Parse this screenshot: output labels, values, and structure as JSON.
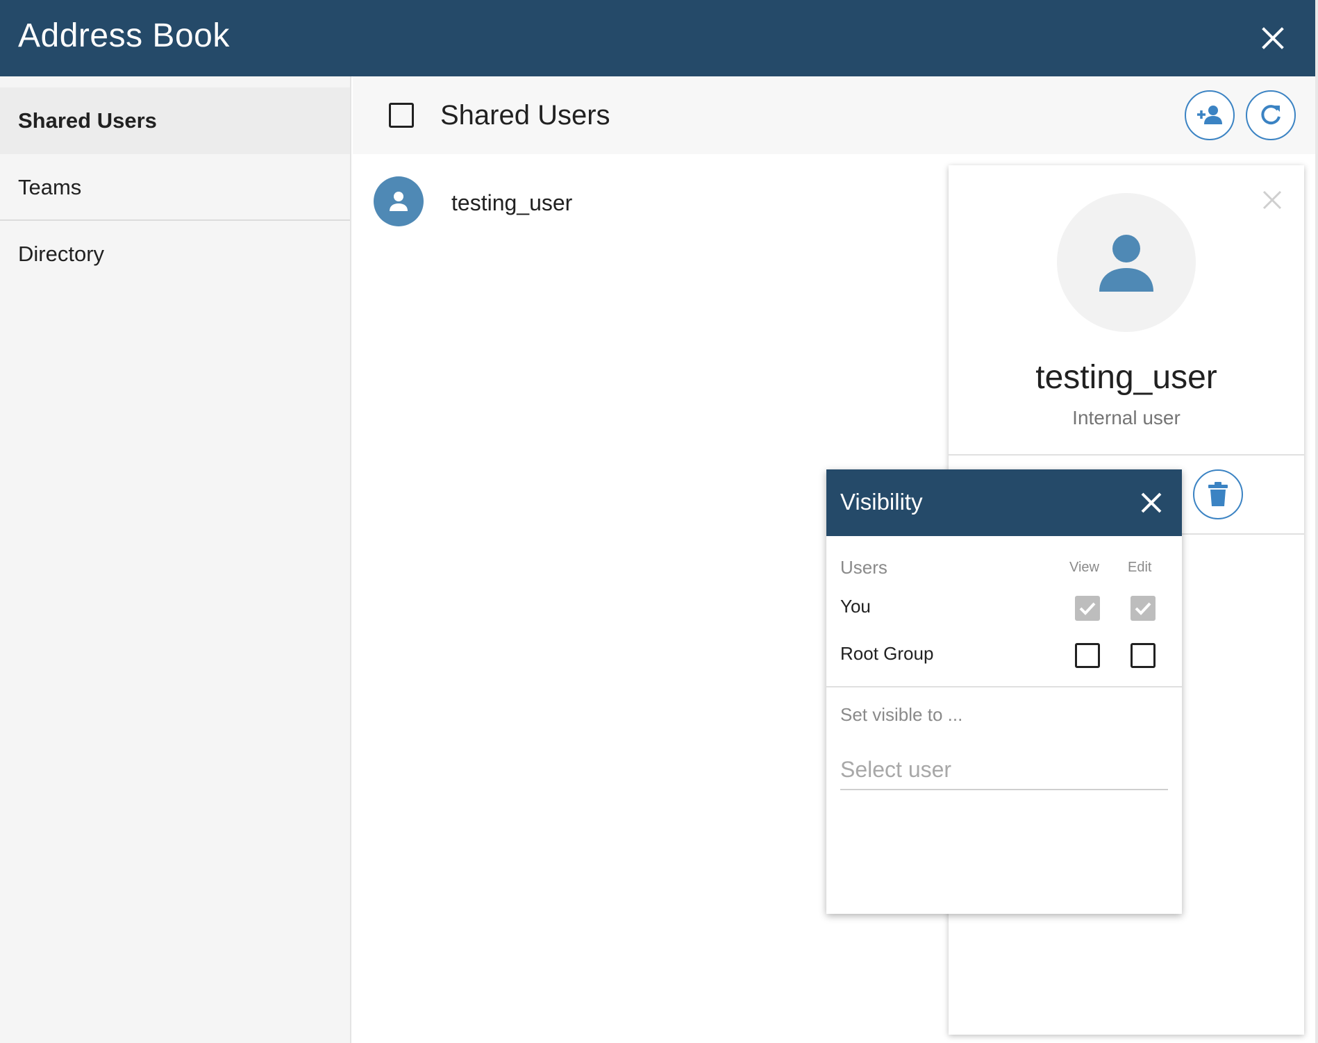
{
  "app": {
    "title": "Address Book"
  },
  "sidebar": {
    "items": [
      {
        "label": "Shared Users",
        "active": true
      },
      {
        "label": "Teams",
        "active": false
      },
      {
        "label": "Directory",
        "active": false
      }
    ]
  },
  "main": {
    "title": "Shared Users",
    "list": [
      {
        "name": "testing_user"
      }
    ]
  },
  "detail": {
    "name": "testing_user",
    "type": "Internal user"
  },
  "visibility": {
    "title": "Visibility",
    "columns": {
      "users": "Users",
      "view": "View",
      "edit": "Edit"
    },
    "rows": [
      {
        "label": "You",
        "view": true,
        "edit": true
      },
      {
        "label": "Root Group",
        "view": false,
        "edit": false
      }
    ],
    "set_visible_label": "Set visible to ...",
    "select_placeholder": "Select user"
  },
  "colors": {
    "header": "#254a69",
    "accent": "#3b83c3",
    "avatar": "#4f89b5"
  },
  "icons": [
    "close-icon",
    "add-user-icon",
    "refresh-icon",
    "person-icon",
    "trash-icon",
    "checkmark-icon"
  ]
}
